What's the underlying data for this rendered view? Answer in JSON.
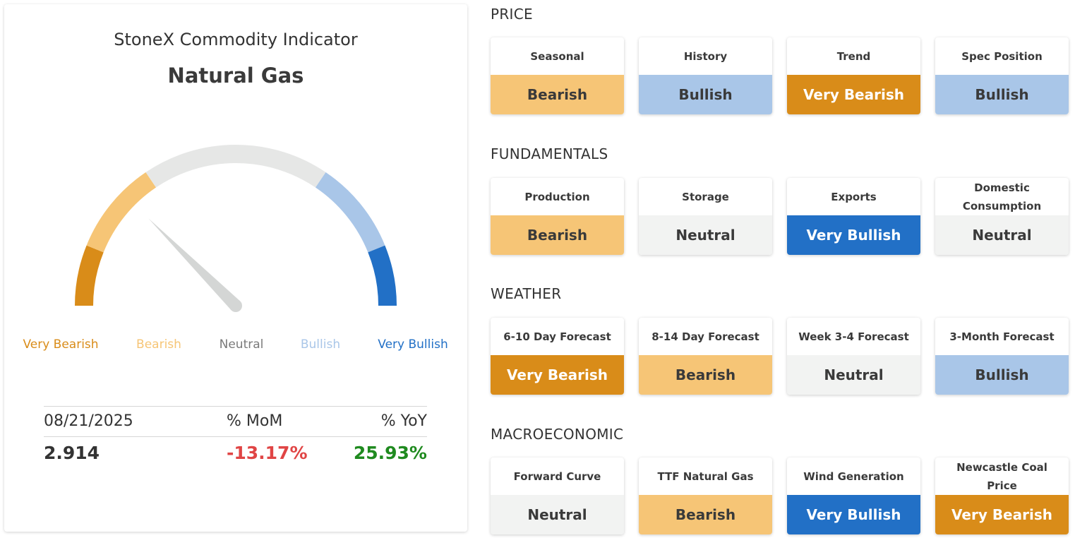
{
  "header": {
    "subtitle": "StoneX Commodity Indicator",
    "commodity": "Natural Gas"
  },
  "gauge": {
    "labels": [
      "Very Bearish",
      "Bearish",
      "Neutral",
      "Bullish",
      "Very Bullish"
    ],
    "label_colors": [
      "#d98c19",
      "#f6c576",
      "#7a7a7a",
      "#a9c6e8",
      "#2270c6"
    ],
    "segment_colors": [
      "#d98c19",
      "#f6c576",
      "#e6e7e6",
      "#a9c6e8",
      "#2270c6"
    ],
    "needle_color": "#d4d6d5",
    "reading": "Bearish"
  },
  "stats": {
    "date": "08/21/2025",
    "mom_label": "% MoM",
    "yoy_label": "% YoY",
    "price": "2.914",
    "mom": "-13.17%",
    "yoy": "25.93%",
    "mom_color": "#e04545",
    "yoy_color": "#1f8a1f"
  },
  "palette": {
    "Very Bearish": {
      "bg": "#d98c19",
      "fg": "#ffffff"
    },
    "Bearish": {
      "bg": "#f6c576",
      "fg": "#3a3a3a"
    },
    "Neutral": {
      "bg": "#f2f3f2",
      "fg": "#3a3a3a"
    },
    "Bullish": {
      "bg": "#a9c6e8",
      "fg": "#3a3a3a"
    },
    "Very Bullish": {
      "bg": "#2270c6",
      "fg": "#ffffff"
    }
  },
  "sections": [
    {
      "title": "PRICE",
      "tiles": [
        {
          "label": "Seasonal",
          "value": "Bearish"
        },
        {
          "label": "History",
          "value": "Bullish"
        },
        {
          "label": "Trend",
          "value": "Very Bearish"
        },
        {
          "label": "Spec Position",
          "value": "Bullish"
        }
      ]
    },
    {
      "title": "FUNDAMENTALS",
      "tiles": [
        {
          "label": "Production",
          "value": "Bearish"
        },
        {
          "label": "Storage",
          "value": "Neutral"
        },
        {
          "label": "Exports",
          "value": "Very Bullish"
        },
        {
          "label": "Domestic Consumption",
          "value": "Neutral"
        }
      ]
    },
    {
      "title": "WEATHER",
      "tiles": [
        {
          "label": "6-10 Day Forecast",
          "value": "Very Bearish"
        },
        {
          "label": "8-14 Day Forecast",
          "value": "Bearish"
        },
        {
          "label": "Week 3-4 Forecast",
          "value": "Neutral"
        },
        {
          "label": "3-Month Forecast",
          "value": "Bullish"
        }
      ]
    },
    {
      "title": "MACROECONOMIC",
      "tiles": [
        {
          "label": "Forward Curve",
          "value": "Neutral"
        },
        {
          "label": "TTF Natural Gas",
          "value": "Bearish"
        },
        {
          "label": "Wind Generation",
          "value": "Very Bullish"
        },
        {
          "label": "Newcastle Coal Price",
          "value": "Very Bearish"
        }
      ]
    }
  ]
}
